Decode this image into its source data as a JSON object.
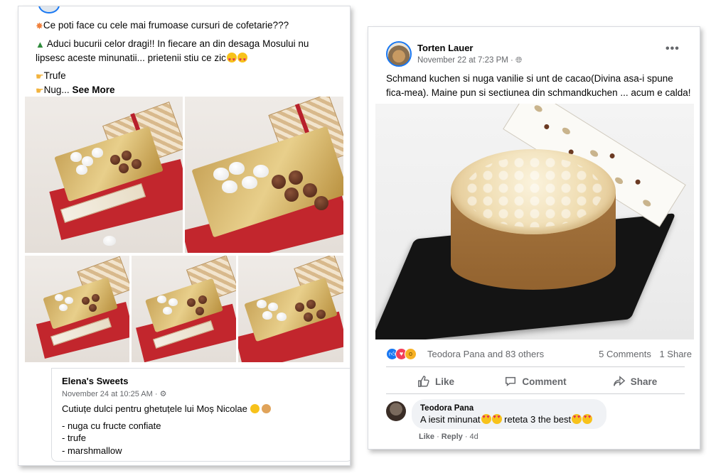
{
  "left_post": {
    "lines": [
      "Ce poti face cu cele mai frumoase cursuri de cofetarie???",
      "Aduci bucurii celor dragi!! In fiecare an din desaga Mosului nu",
      "lipsesc aceste minunatii... prietenii stiu ce zic",
      "Trufe",
      "Nug..."
    ],
    "see_more": "See More",
    "shared": {
      "author": "Elena's Sweets",
      "time": "November 24 at 10:25 AM ·",
      "text_1": "Cutiuțe dulci pentru ghetuțele lui Moș Nicolae",
      "items": [
        "- nuga cu fructe confiate",
        "- trufe",
        "- marshmallow"
      ]
    }
  },
  "right_post": {
    "author": "Torten Lauer",
    "time": "November 22 at 7:23 PM ·",
    "more": "•••",
    "text": "Schmand kuchen si nuga vanilie si unt de cacao(Divina asa-i spune fica-mea). Maine pun si sectiunea din schmandkuchen ... acum e calda!",
    "reactions": {
      "names": "Teodora Pana and 83 others",
      "comments": "5 Comments",
      "shares": "1 Share"
    },
    "actions": {
      "like": "Like",
      "comment": "Comment",
      "share": "Share"
    },
    "comment": {
      "author": "Teodora Pana",
      "text_a": "A iesit minunat",
      "text_b": " reteta 3 the best",
      "like": "Like",
      "reply": "Reply",
      "age": "4d"
    }
  },
  "icons": [
    "burst-icon",
    "tree-icon",
    "pointing-hand-icon",
    "heart-eyes-icon",
    "gear-icon",
    "globe-icon",
    "like-icon",
    "love-icon",
    "wow-icon",
    "comment-icon",
    "share-icon"
  ],
  "colors": {
    "accent": "#1877f2",
    "meta": "#65676b",
    "ribbon": "#c2262d"
  }
}
